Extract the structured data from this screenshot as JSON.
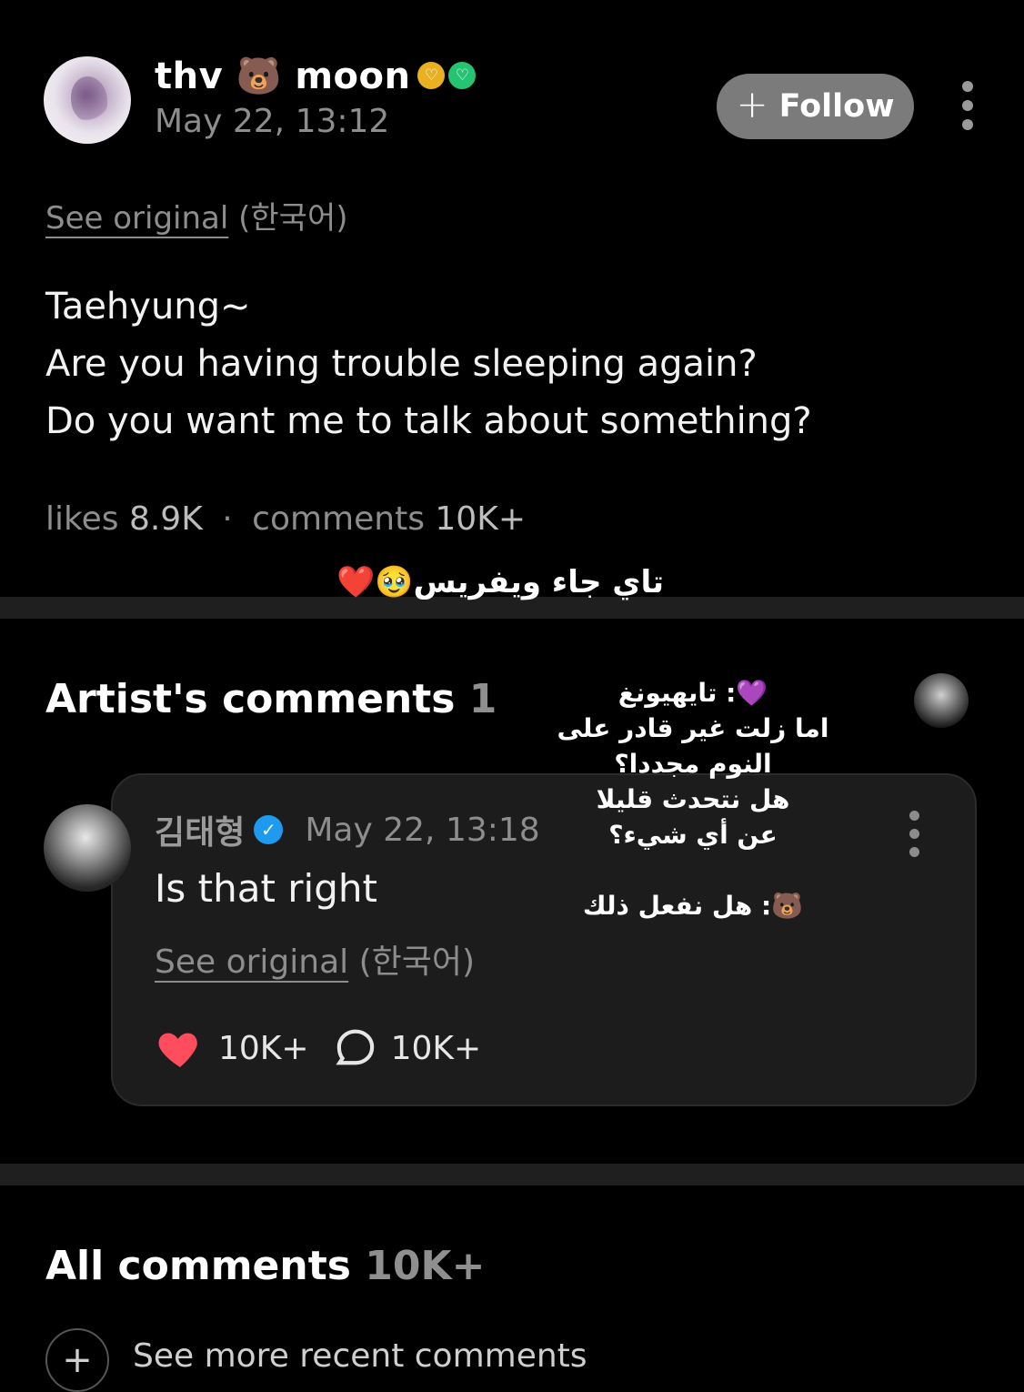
{
  "post": {
    "author": "thv 🐻 moon",
    "date": "May 22, 13:12",
    "follow_label": "Follow",
    "see_original": "See original",
    "original_lang": "(한국어)",
    "body_lines": [
      "Taehyung~",
      "Are you having trouble sleeping again?",
      "Do you want me to talk about something?"
    ],
    "likes_label": "likes",
    "likes_count": "8.9K",
    "comments_label": "comments",
    "comments_count": "10K+"
  },
  "overlay": {
    "caption": "تاي جاء ويفريس🥹❤️",
    "arabic_lines": [
      "💜: تايهيونغ",
      "اما زلت غير قادر على",
      "النوم مجددا؟",
      "هل نتحدث قليلا",
      "عن أي شيء؟",
      "",
      "🐻: هل نفعل ذلك"
    ]
  },
  "artist_comments": {
    "title": "Artist's comments",
    "count": "1",
    "comment": {
      "author": "김태형",
      "date": "May 22, 13:18",
      "text": "Is that right",
      "see_original": "See original",
      "original_lang": "(한국어)",
      "likes": "10K+",
      "replies": "10K+"
    }
  },
  "all_comments": {
    "title": "All comments",
    "count": "10K+",
    "see_more": "See more recent comments"
  },
  "colors": {
    "background": "#000000",
    "follow_button": "#7b7b7b",
    "heart": "#ff4d5e",
    "verified": "#1e9bf0"
  }
}
